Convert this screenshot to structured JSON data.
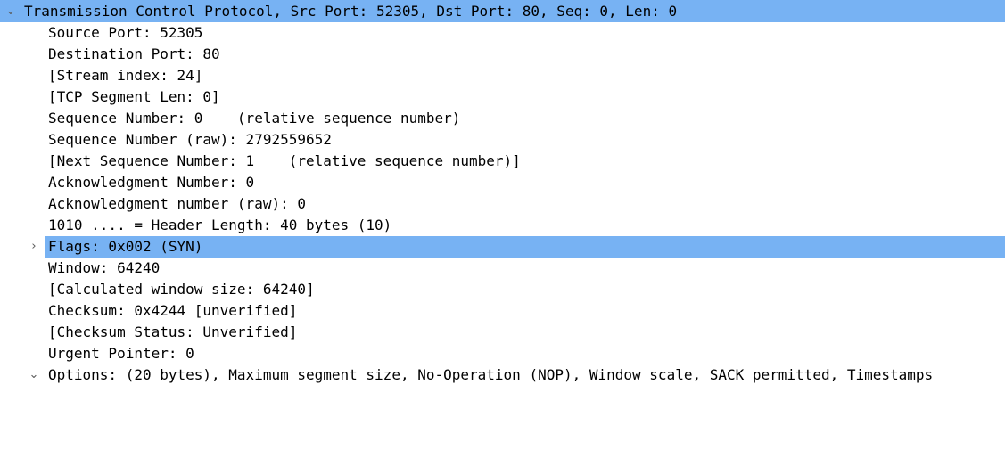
{
  "tcp": {
    "header": "Transmission Control Protocol, Src Port: 52305, Dst Port: 80, Seq: 0, Len: 0",
    "fields": {
      "src_port": "Source Port: 52305",
      "dst_port": "Destination Port: 80",
      "stream_index": "[Stream index: 24]",
      "segment_len": "[TCP Segment Len: 0]",
      "seq_num": "Sequence Number: 0    (relative sequence number)",
      "seq_raw": "Sequence Number (raw): 2792559652",
      "next_seq": "[Next Sequence Number: 1    (relative sequence number)]",
      "ack_num": "Acknowledgment Number: 0",
      "ack_raw": "Acknowledgment number (raw): 0",
      "header_len": "1010 .... = Header Length: 40 bytes (10)",
      "flags": "Flags: 0x002 (SYN)",
      "window": "Window: 64240",
      "calc_window": "[Calculated window size: 64240]",
      "checksum": "Checksum: 0x4244 [unverified]",
      "checksum_status": "[Checksum Status: Unverified]",
      "urgent": "Urgent Pointer: 0",
      "options": "Options: (20 bytes), Maximum segment size, No-Operation (NOP), Window scale, SACK permitted, Timestamps"
    }
  },
  "icons": {
    "expanded": "chevron-down-icon",
    "collapsed": "chevron-right-icon"
  },
  "colors": {
    "selection": "#77b2f3"
  }
}
